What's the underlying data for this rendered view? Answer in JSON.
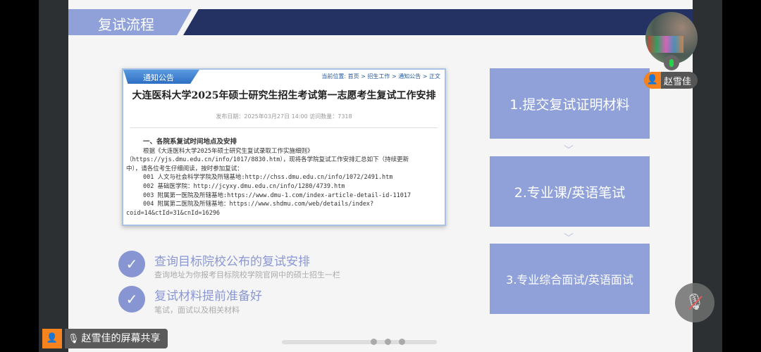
{
  "slide": {
    "header_title": "复试流程",
    "notice": {
      "tab": "通知公告",
      "breadcrumb": "当前位置: 首页 > 招生工作 > 通知公告 > 正文",
      "title": "大连医科大学2025年硕士研究生招生考试第一志愿考生复试工作安排",
      "meta": "发布日期：2025年03月27日 14:00 访问数量：7318",
      "lines": [
        "一、各院系复试时间地点及安排",
        "根据《大连医科大学2025年硕士研究生复试录取工作实施细则》",
        "（https://yjs.dmu.edu.cn/info/1017/8830.htm），现将各学院复试工作安排汇总如下（持续更新",
        "中），请各位考生仔细阅读，按时参加复试：",
        "001 人文与社会科学学院及所辖基地:http://chss.dmu.edu.cn/info/1072/2491.htm",
        "002 基础医学院：http://jcyxy.dmu.edu.cn/info/1280/4739.htm",
        "003 附属第一医院及所辖基地:https://www.dmu-1.com/index-article-detail-id-11017",
        "004 附属第二医院及所辖基地：https://www.shdmu.com/web/details/index?",
        "coid=14&ctId=31&cnId=16296"
      ]
    },
    "points": [
      {
        "title": "查询目标院校公布的复试安排",
        "subtitle": "查询地址为你报考目标院校学院官网中的硕士招生一栏"
      },
      {
        "title": "复试材料提前准备好",
        "subtitle": "笔试，面试以及相关材料"
      }
    ],
    "steps": [
      "1.提交复试证明材料",
      "2.专业课/英语笔试",
      "3.专业综合面试/英语面试"
    ]
  },
  "meeting": {
    "participant_name": "赵雪佳",
    "share_label": "赵雪佳的屏幕共享"
  }
}
